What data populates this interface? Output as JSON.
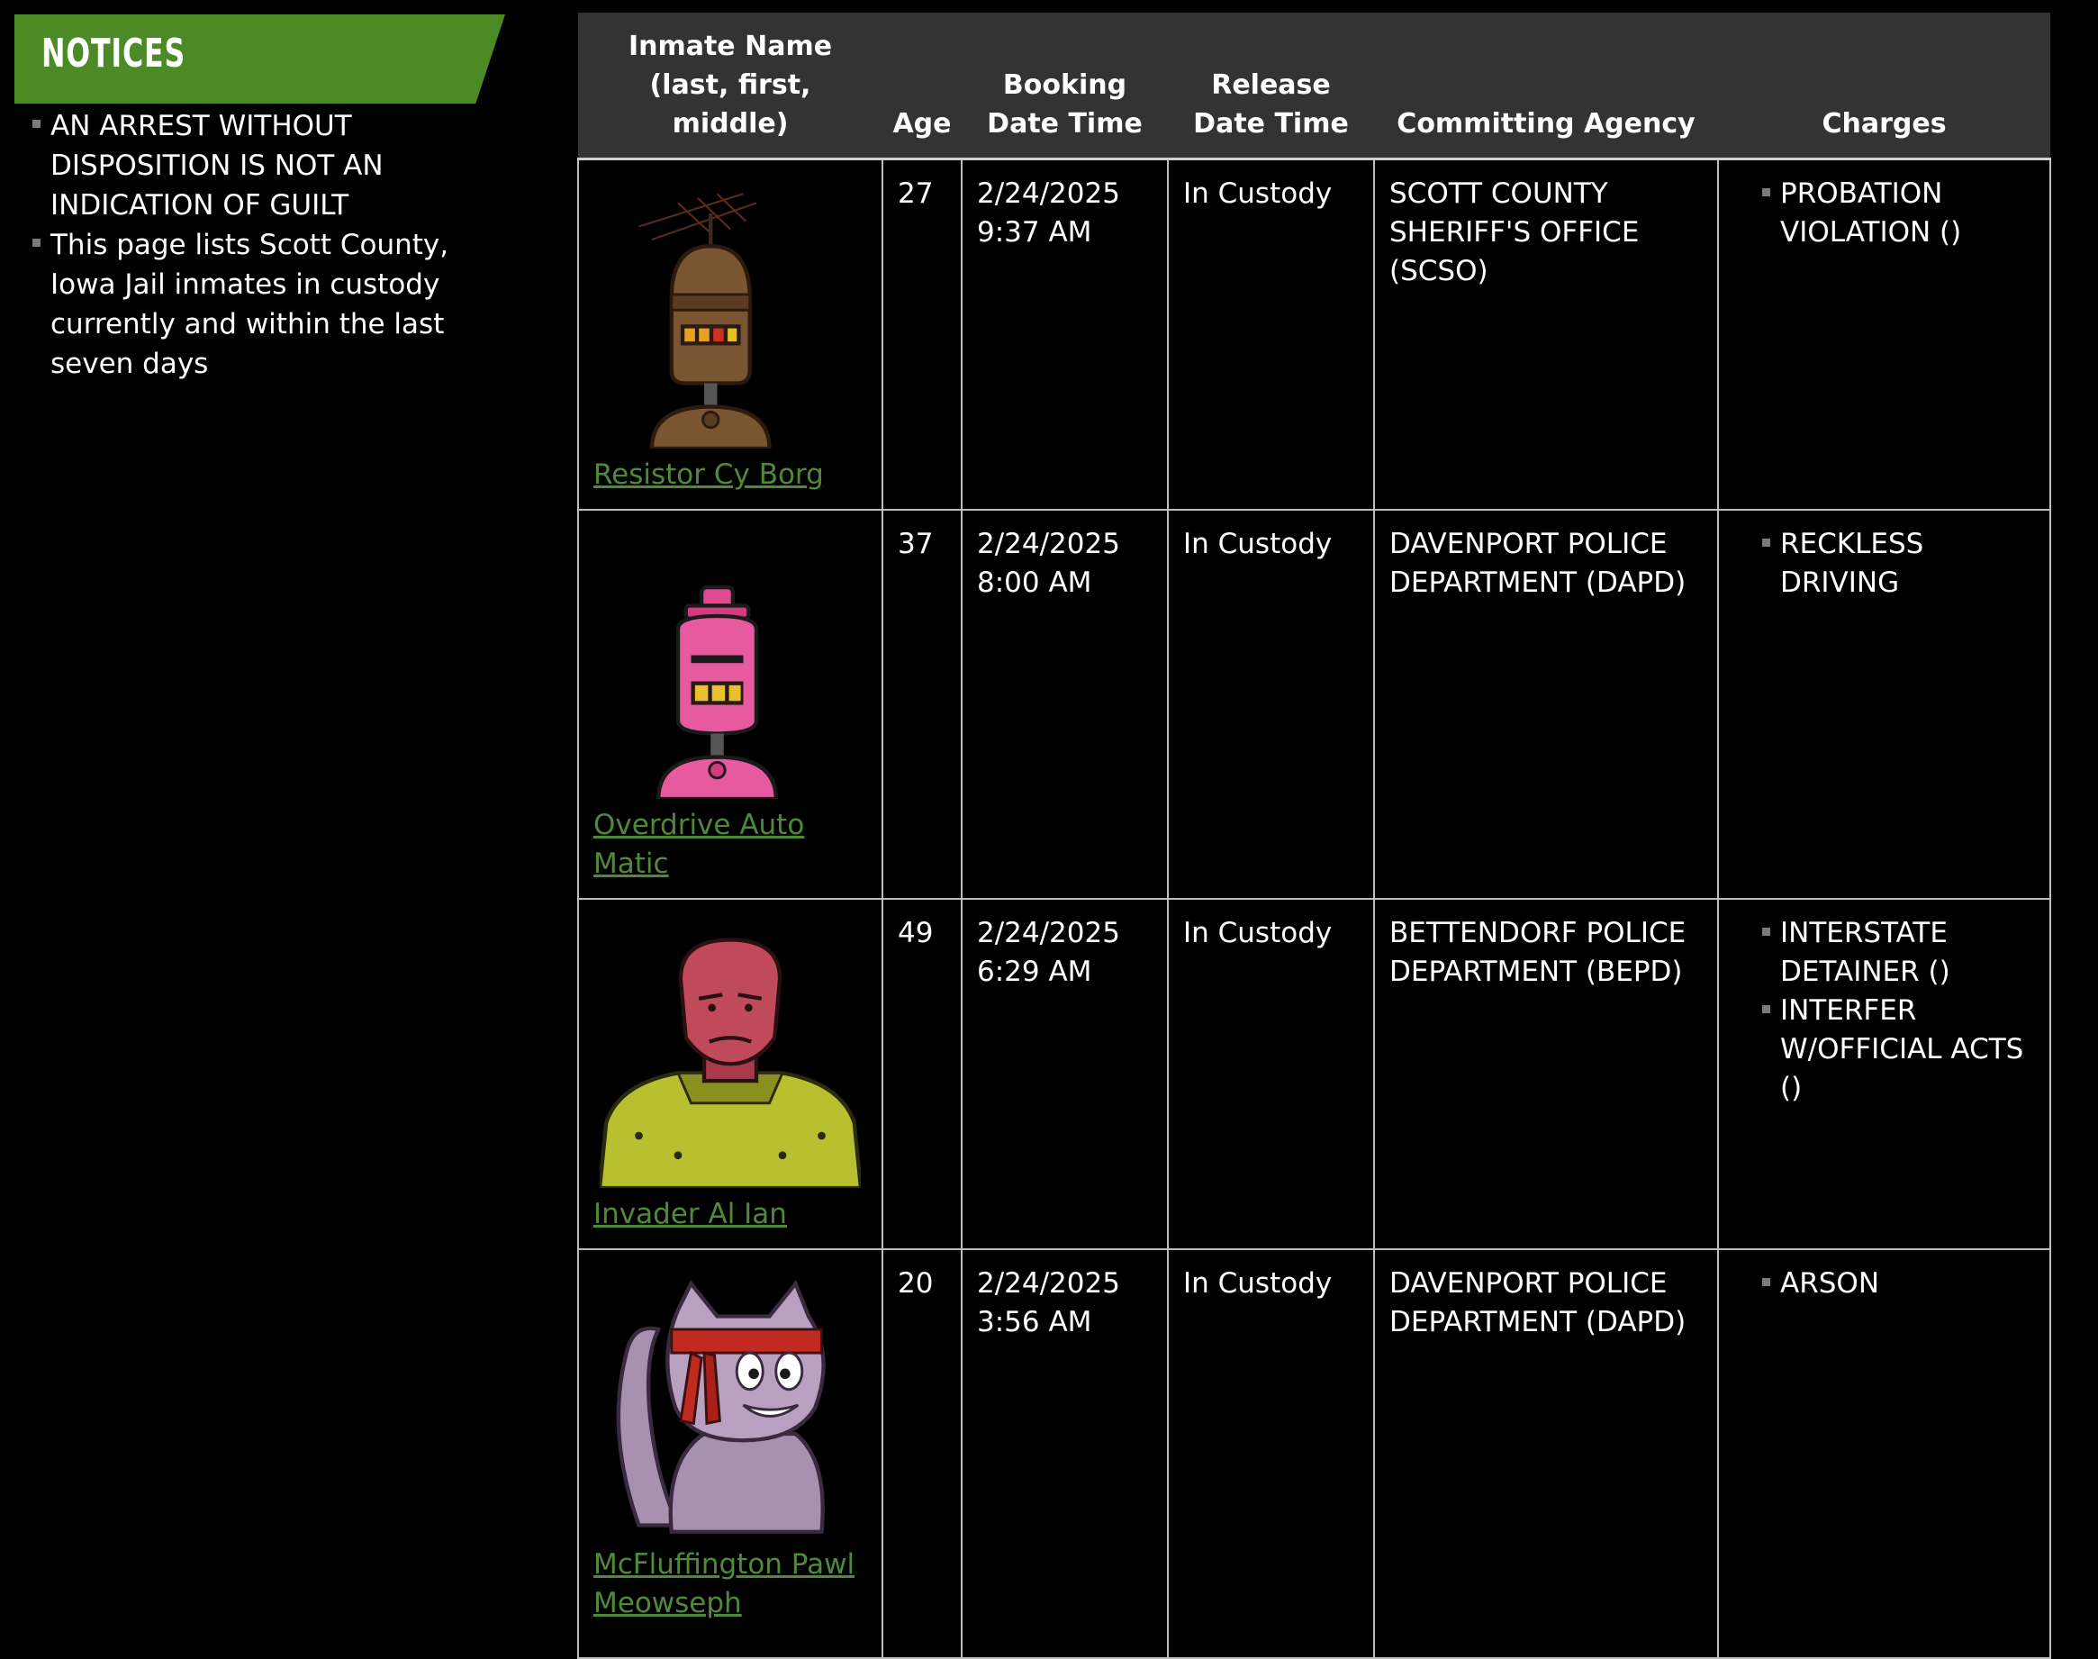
{
  "notices": {
    "title": "NOTICES",
    "items": [
      "AN ARREST WITHOUT DISPOSITION IS NOT AN INDICATION OF GUILT",
      "This page lists Scott County, Iowa Jail inmates in custody currently and within the last seven days"
    ]
  },
  "table": {
    "headers": {
      "name": "Inmate Name (last, first, middle)",
      "age": "Age",
      "booking": "Booking Date Time",
      "release": "Release Date Time",
      "agency": "Committing Agency",
      "charges": "Charges"
    },
    "rows": [
      {
        "name": "Resistor Cy Borg",
        "portrait": "brown-robot-portrait",
        "age": "27",
        "booking": "2/24/2025 9:37 AM",
        "release": "In Custody",
        "agency": "SCOTT COUNTY SHERIFF'S OFFICE (SCSO)",
        "charges": [
          "PROBATION VIOLATION ()"
        ]
      },
      {
        "name": "Overdrive Auto Matic",
        "portrait": "pink-robot-portrait",
        "age": "37",
        "booking": "2/24/2025 8:00 AM",
        "release": "In Custody",
        "agency": "DAVENPORT POLICE DEPARTMENT (DAPD)",
        "charges": [
          "RECKLESS DRIVING"
        ]
      },
      {
        "name": "Invader Al Ian",
        "portrait": "red-alien-portrait",
        "age": "49",
        "booking": "2/24/2025 6:29 AM",
        "release": "In Custody",
        "agency": "BETTENDORF POLICE DEPARTMENT (BEPD)",
        "charges": [
          "INTERSTATE DETAINER ()",
          "INTERFER W/OFFICIAL ACTS ()"
        ]
      },
      {
        "name": "McFluffington Pawl Meowseph",
        "portrait": "purple-cat-portrait",
        "age": "20",
        "booking": "2/24/2025 3:56 AM",
        "release": "In Custody",
        "agency": "DAVENPORT POLICE DEPARTMENT (DAPD)",
        "charges": [
          "ARSON"
        ]
      }
    ]
  },
  "colors": {
    "accent": "#4b8a24",
    "link": "#4f8a3a",
    "header_bg": "#333333",
    "background": "#000000"
  }
}
